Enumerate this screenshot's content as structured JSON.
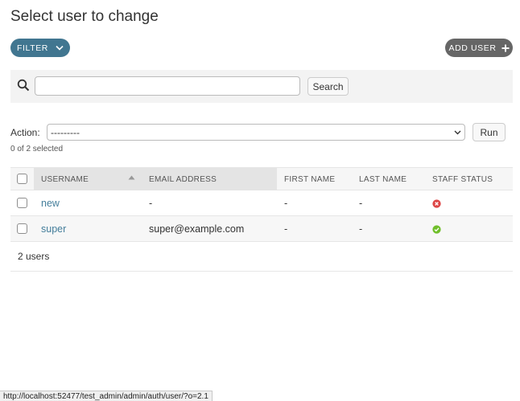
{
  "page": {
    "title": "Select user to change"
  },
  "toolbar": {
    "filter_label": "FILTER",
    "add_label": "ADD USER"
  },
  "search": {
    "value": "",
    "button_label": "Search"
  },
  "actions": {
    "label": "Action:",
    "selected_value": "---------",
    "run_label": "Run",
    "selected_count": "0 of 2 selected"
  },
  "table": {
    "headers": {
      "username": "USERNAME",
      "email": "EMAIL ADDRESS",
      "first_name": "FIRST NAME",
      "last_name": "LAST NAME",
      "staff_status": "STAFF STATUS"
    },
    "rows": [
      {
        "username": "new",
        "email": "-",
        "first_name": "-",
        "last_name": "-",
        "staff": false
      },
      {
        "username": "super",
        "email": "super@example.com",
        "first_name": "-",
        "last_name": "-",
        "staff": true
      }
    ],
    "footer": "2 users"
  },
  "statusbar": {
    "url": "http://localhost:52477/test_admin/admin/auth/user/?o=2.1"
  },
  "colors": {
    "primary": "#417690",
    "link": "#447e9b",
    "yes": "#70bf2b",
    "no": "#dd4646",
    "add_button": "#666666"
  },
  "icons": {
    "filter": "chevron-down-icon",
    "add": "plus-icon",
    "search": "search-icon",
    "select": "chevron-down-icon",
    "staff_yes": "check-circle-icon",
    "staff_no": "x-circle-icon"
  }
}
